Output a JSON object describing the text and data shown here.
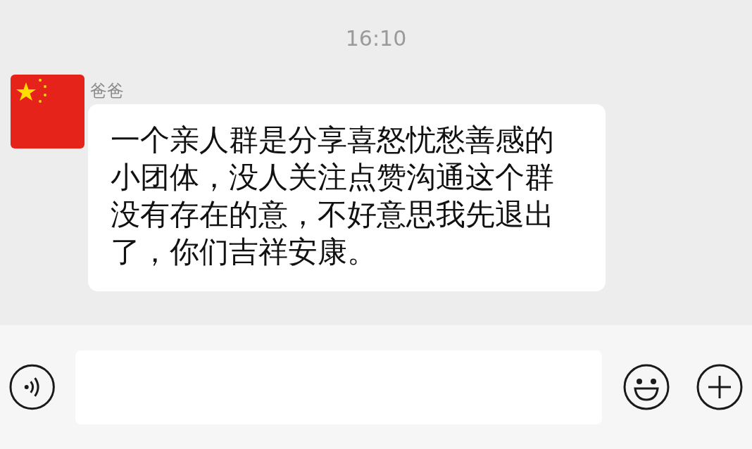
{
  "time": "16:10",
  "messages": [
    {
      "sender": "爸爸",
      "text": "一个亲人群是分享喜怒忧愁善感的小团体，没人关注点赞沟通这个群没有存在的意，不好意思我先退出了，你们吉祥安康。"
    }
  ]
}
